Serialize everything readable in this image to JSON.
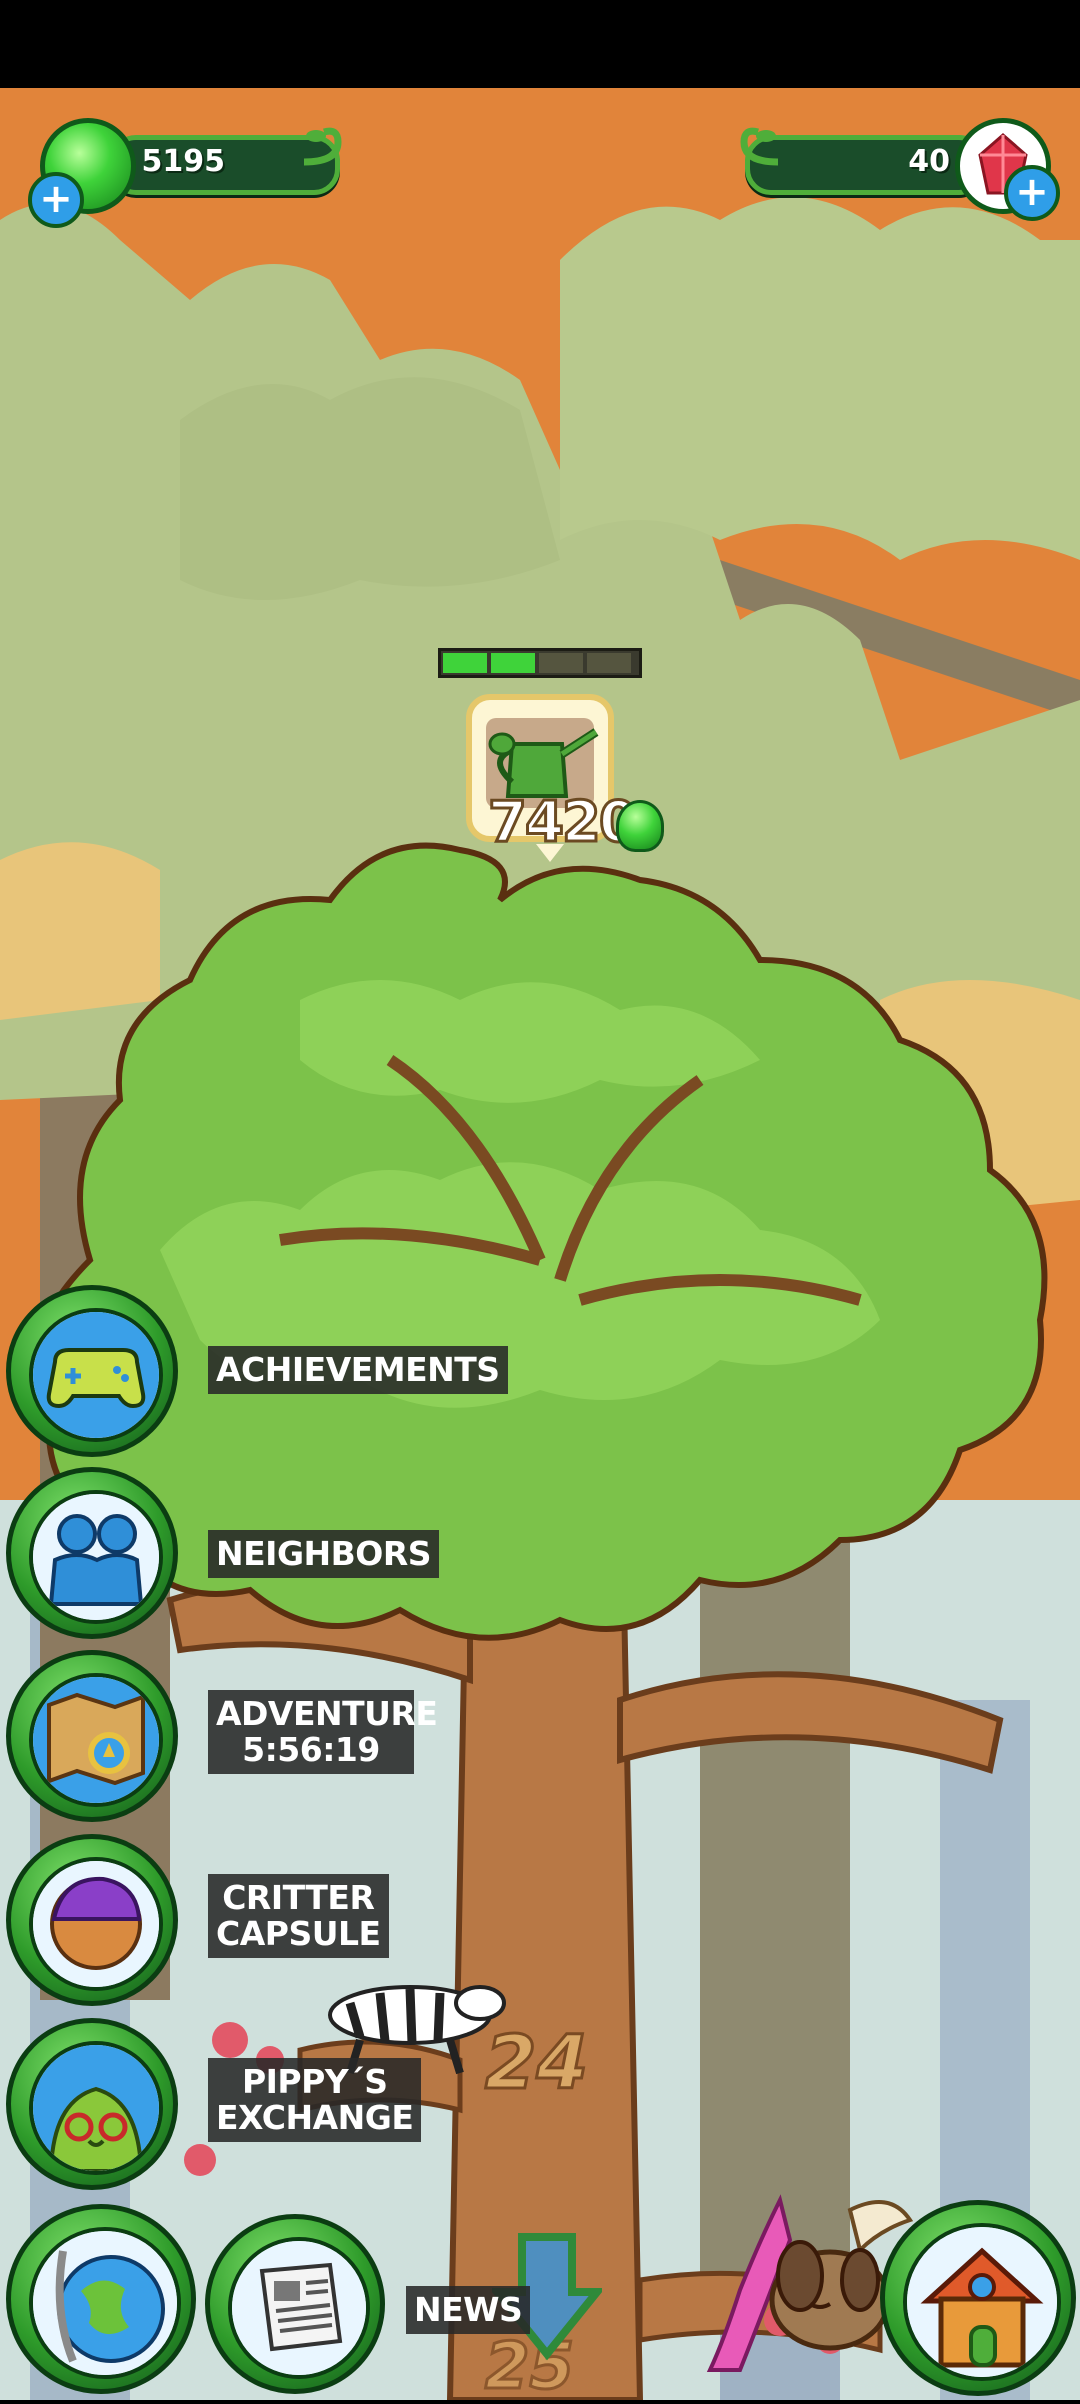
{
  "hud": {
    "gems": "5195",
    "rubies": "40"
  },
  "task": {
    "cost": "7420",
    "progress_filled": 2,
    "progress_total": 4
  },
  "menu": [
    {
      "label": "ACHIEVEMENTS",
      "icon": "gamepad-icon"
    },
    {
      "label": "NEIGHBORS",
      "icon": "neighbors-icon"
    },
    {
      "label": "ADVENTURE\n5:56:19",
      "icon": "treasure-map-icon"
    },
    {
      "label": "CRITTER\nCAPSULE",
      "icon": "capsule-icon"
    },
    {
      "label": "PIPPY´S\nEXCHANGE",
      "icon": "pippy-icon"
    }
  ],
  "bottom": {
    "news_label": "NEWS",
    "tree_level": "24",
    "next_level": "25"
  },
  "colors": {
    "sky": "#e1843a",
    "bg_foliage": "#b4c58a",
    "leaf": "#7cc24a",
    "trunk": "#b87845",
    "button_green": "#2e9b2a"
  }
}
